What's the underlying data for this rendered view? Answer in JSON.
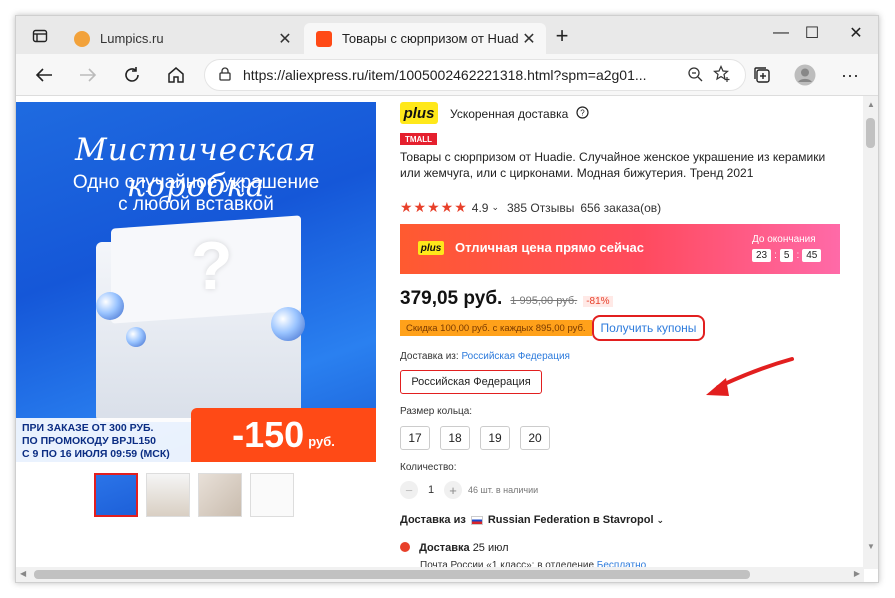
{
  "browser": {
    "tabs": [
      {
        "title": "Lumpics.ru",
        "active": false
      },
      {
        "title": "Товары с сюрпризом от Huadie",
        "active": true
      }
    ],
    "new_tab_label": "+",
    "url": "https://aliexpress.ru/item/1005002462221318.html?spm=a2g01...",
    "controls": {
      "minimize": "—",
      "maximize": "☐",
      "close": "✕"
    }
  },
  "product": {
    "plus_badge": "plus",
    "fast_delivery": "Ускоренная доставка",
    "tmall_badge": "TMALL",
    "title": "Товары с сюрпризом от Huadie. Случайное женское украшение из керамики или жемчуга, или с цирконами. Модная бижутерия. Тренд 2021",
    "rating": "4.9",
    "reviews": "385 Отзывы",
    "orders": "656 заказа(ов)",
    "banner": {
      "plus": "plus",
      "text": "Отличная цена прямо сейчас",
      "timer_label": "До окончания",
      "timer": [
        "23",
        "5",
        "45"
      ]
    },
    "price_now": "379,05 руб.",
    "price_old": "1 995,00 руб.",
    "discount_pct": "-81%",
    "coupon_text": "Скидка 100,00 руб. с каждых 895,00 руб.",
    "get_coupons": "Получить купоны",
    "ship_from_label": "Доставка из:",
    "ship_from_value": "Российская Федерация",
    "ship_option": "Российская Федерация",
    "ring_size_label": "Размер кольца:",
    "sizes": [
      "17",
      "18",
      "19",
      "20"
    ],
    "qty_label": "Количество:",
    "qty_minus": "−",
    "qty_value": "1",
    "qty_plus": "+",
    "stock": "46 шт. в наличии",
    "delivery_from_prefix": "Доставка из",
    "delivery_from_place": "Russian Federation в Stavropol",
    "delivery_label": "Доставка",
    "delivery_date": "25 июл",
    "delivery_method": "Почта России «1 класс»: в отделение",
    "delivery_price": "Бесплатно"
  },
  "promo_image": {
    "headline": "Мистическая коробка",
    "subline1": "Одно случайное украшение",
    "subline2": "с любой вставкой",
    "strip_line1": "ПРИ ЗАКАЗЕ ОТ 300 РУБ.",
    "strip_line2": "ПО ПРОМОКОДУ BPJL150",
    "strip_line3": "С 9 ПО 16 ИЮЛЯ 09:59 (МСК)",
    "discount": "-150",
    "discount_unit": "руб."
  },
  "colors": {
    "accent_red": "#e21f1f",
    "link_blue": "#2d7bdc",
    "plus_yellow": "#ffe81a"
  }
}
